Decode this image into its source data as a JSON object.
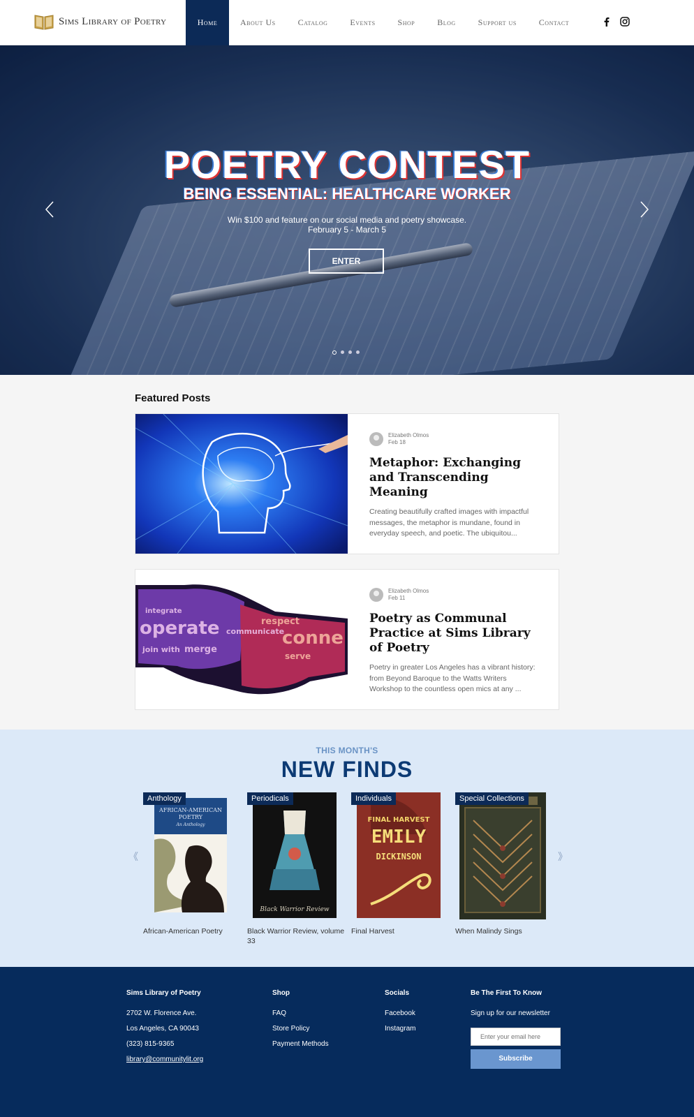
{
  "nav": {
    "brand": "Sims Library of Poetry",
    "items": [
      "Home",
      "About Us",
      "Catalog",
      "Events",
      "Shop",
      "Blog",
      "Support us",
      "Contact"
    ],
    "social": [
      "facebook-icon",
      "instagram-icon"
    ]
  },
  "hero": {
    "title": "POETRY CONTEST",
    "subtitle": "BEING ESSENTIAL: HEALTHCARE WORKER",
    "line1": "Win $100 and feature on our social media and poetry showcase.",
    "line2": "February 5 - March 5",
    "button": "ENTER",
    "slides_count": 4,
    "active_slide": 1
  },
  "featured": {
    "title": "Featured Posts",
    "posts": [
      {
        "author": "Elizabeth Olmos",
        "date": "Feb 18",
        "title": "Metaphor: Exchanging and Transcending Meaning",
        "excerpt": "Creating beautifully crafted images with impactful messages, the metaphor is mundane, found in everyday speech, and poetic. The ubiquitou..."
      },
      {
        "author": "Elizabeth Olmos",
        "date": "Feb 11",
        "title": "Poetry as Communal Practice at Sims Library of Poetry",
        "excerpt": "Poetry in greater Los Angeles has a vibrant history: from Beyond Baroque to the Watts Writers Workshop to the countless open mics at any ..."
      }
    ]
  },
  "finds": {
    "kicker": "THIS MONTH'S",
    "title": "NEW FINDS",
    "books": [
      {
        "tag": "Anthology",
        "caption": "African-American Poetry"
      },
      {
        "tag": "Periodicals",
        "caption": "Black Warrior Review, volume 33"
      },
      {
        "tag": "Individuals",
        "caption": "Final Harvest"
      },
      {
        "tag": "Special Collections",
        "caption": "When Malindy Sings"
      }
    ],
    "covers": {
      "book1": {
        "line1": "AFRICAN-AMERICAN",
        "line2": "POETRY",
        "line3": "An Anthology"
      },
      "book2": {
        "bottom": "Black Warrior Review"
      },
      "book3": {
        "line1": "FINAL HARVEST",
        "line2": "EMILY",
        "line3": "DICKINSON"
      }
    }
  },
  "footer": {
    "col1": {
      "head": "Sims Library of Poetry",
      "lines": [
        "2702 W. Florence Ave.",
        "Los Angeles, CA 90043",
        "(323) 815-9365"
      ],
      "email": "library@communitylit.org"
    },
    "col2": {
      "head": "Shop",
      "lines": [
        "FAQ",
        "Store Policy",
        "Payment Methods"
      ]
    },
    "col3": {
      "head": "Socials",
      "lines": [
        "Facebook",
        "Instagram"
      ]
    },
    "col4": {
      "head": "Be The First To Know",
      "text": "Sign up for our newsletter",
      "placeholder": "Enter your email here",
      "button": "Subscribe"
    }
  },
  "colors": {
    "navy": "#0c2a57",
    "footer": "#062b5c",
    "finds_bg": "#dce9f8",
    "accent": "#6a96cf"
  }
}
